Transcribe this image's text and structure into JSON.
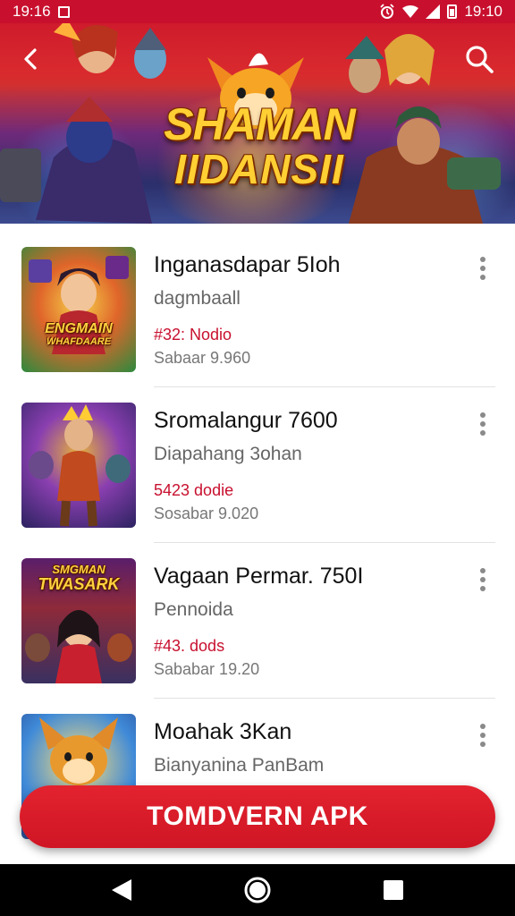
{
  "status_bar": {
    "time_left": "19:16",
    "time_right": "19:10",
    "icons": [
      "notification-square-icon",
      "alarm-icon",
      "wifi-icon",
      "signal-icon",
      "battery-icon"
    ]
  },
  "header": {
    "back_icon": "chevron-left-icon",
    "search_icon": "search-icon",
    "banner_title_line1": "SHAMAN",
    "banner_title_line2": "IIDANSII"
  },
  "items": [
    {
      "title": "Inganasdapar 5Ioh",
      "subtitle": "dagmbaall",
      "price": "#32: Nodio",
      "meta": "Sabaar 9.960",
      "thumb_text_1": "ENGMAIN",
      "thumb_text_2": "WHAFDAARE"
    },
    {
      "title": "Sromalangur 7600",
      "subtitle": "Diapahang 3ohan",
      "price": "5423 dodie",
      "meta": "Sosabar 9.020"
    },
    {
      "title": "Vagaan Permar. 750I",
      "subtitle": "Pennoida",
      "price": "#43. dods",
      "meta": "Sababar 19.20",
      "thumb_text_1": "SMGMAN",
      "thumb_text_2": "TWASARK"
    },
    {
      "title": "Moahak 3Kan",
      "subtitle": "Bianyanina PanBam"
    }
  ],
  "download_button": {
    "label": "TOMDVERN APK"
  },
  "colors": {
    "accent": "#c8102e",
    "button": "#dd1f2c",
    "price": "#c8102e",
    "nav_bar": "#000000"
  },
  "nav_bar": {
    "back_icon": "nav-back-icon",
    "home_icon": "nav-home-icon",
    "recents_icon": "nav-recents-icon"
  }
}
